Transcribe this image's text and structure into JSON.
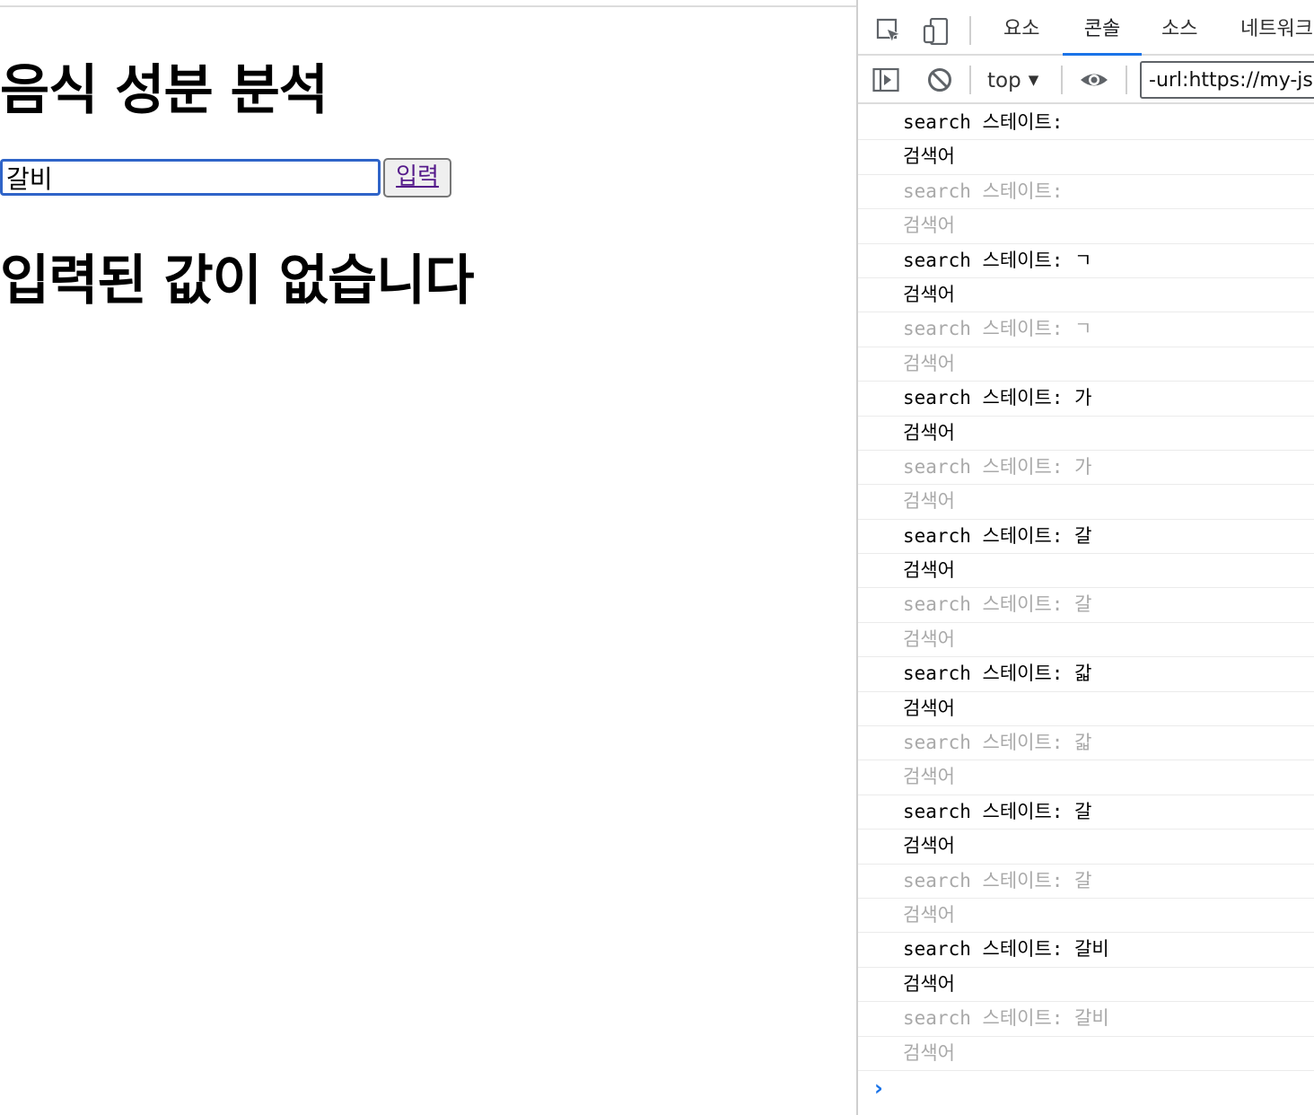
{
  "page": {
    "title": "음식 성분 분석",
    "search_value": "갈비",
    "submit_label": "입력",
    "result_message": "입력된 값이 없습니다"
  },
  "devtools": {
    "tabs": [
      {
        "label": "요소",
        "active": false
      },
      {
        "label": "콘솔",
        "active": true
      },
      {
        "label": "소스",
        "active": false
      },
      {
        "label": "네트워크",
        "active": false
      }
    ],
    "context": "top",
    "filter_value": "-url:https://my-json",
    "console_rows": [
      {
        "text": "search 스테이트: ",
        "kind": "state",
        "dim": false
      },
      {
        "text": "검색어",
        "kind": "label",
        "dim": false
      },
      {
        "text": "search 스테이트: ",
        "kind": "state",
        "dim": true
      },
      {
        "text": "검색어",
        "kind": "label",
        "dim": true
      },
      {
        "text": "search 스테이트: ㄱ",
        "kind": "state",
        "dim": false
      },
      {
        "text": "검색어",
        "kind": "label",
        "dim": false
      },
      {
        "text": "search 스테이트: ㄱ",
        "kind": "state",
        "dim": true
      },
      {
        "text": "검색어",
        "kind": "label",
        "dim": true
      },
      {
        "text": "search 스테이트: 가",
        "kind": "state",
        "dim": false
      },
      {
        "text": "검색어",
        "kind": "label",
        "dim": false
      },
      {
        "text": "search 스테이트: 가",
        "kind": "state",
        "dim": true
      },
      {
        "text": "검색어",
        "kind": "label",
        "dim": true
      },
      {
        "text": "search 스테이트: 갈",
        "kind": "state",
        "dim": false
      },
      {
        "text": "검색어",
        "kind": "label",
        "dim": false
      },
      {
        "text": "search 스테이트: 갈",
        "kind": "state",
        "dim": true
      },
      {
        "text": "검색어",
        "kind": "label",
        "dim": true
      },
      {
        "text": "search 스테이트: 갋",
        "kind": "state",
        "dim": false
      },
      {
        "text": "검색어",
        "kind": "label",
        "dim": false
      },
      {
        "text": "search 스테이트: 갋",
        "kind": "state",
        "dim": true
      },
      {
        "text": "검색어",
        "kind": "label",
        "dim": true
      },
      {
        "text": "search 스테이트: 갈",
        "kind": "state",
        "dim": false
      },
      {
        "text": "검색어",
        "kind": "label",
        "dim": false
      },
      {
        "text": "search 스테이트: 갈",
        "kind": "state",
        "dim": true
      },
      {
        "text": "검색어",
        "kind": "label",
        "dim": true
      },
      {
        "text": "search 스테이트: 갈비",
        "kind": "state",
        "dim": false
      },
      {
        "text": "검색어",
        "kind": "label",
        "dim": false
      },
      {
        "text": "search 스테이트: 갈비",
        "kind": "state",
        "dim": true
      },
      {
        "text": "검색어",
        "kind": "label",
        "dim": true
      }
    ],
    "prompt_glyph": "›",
    "icons": [
      "inspect-icon",
      "device-toggle-icon",
      "sidebar-toggle-icon",
      "clear-console-icon",
      "eye-icon"
    ],
    "colors": {
      "accent": "#1a73e8",
      "input_focus": "#2f64c8",
      "link": "#551a8b",
      "dim_text": "#a9a9a9"
    }
  }
}
